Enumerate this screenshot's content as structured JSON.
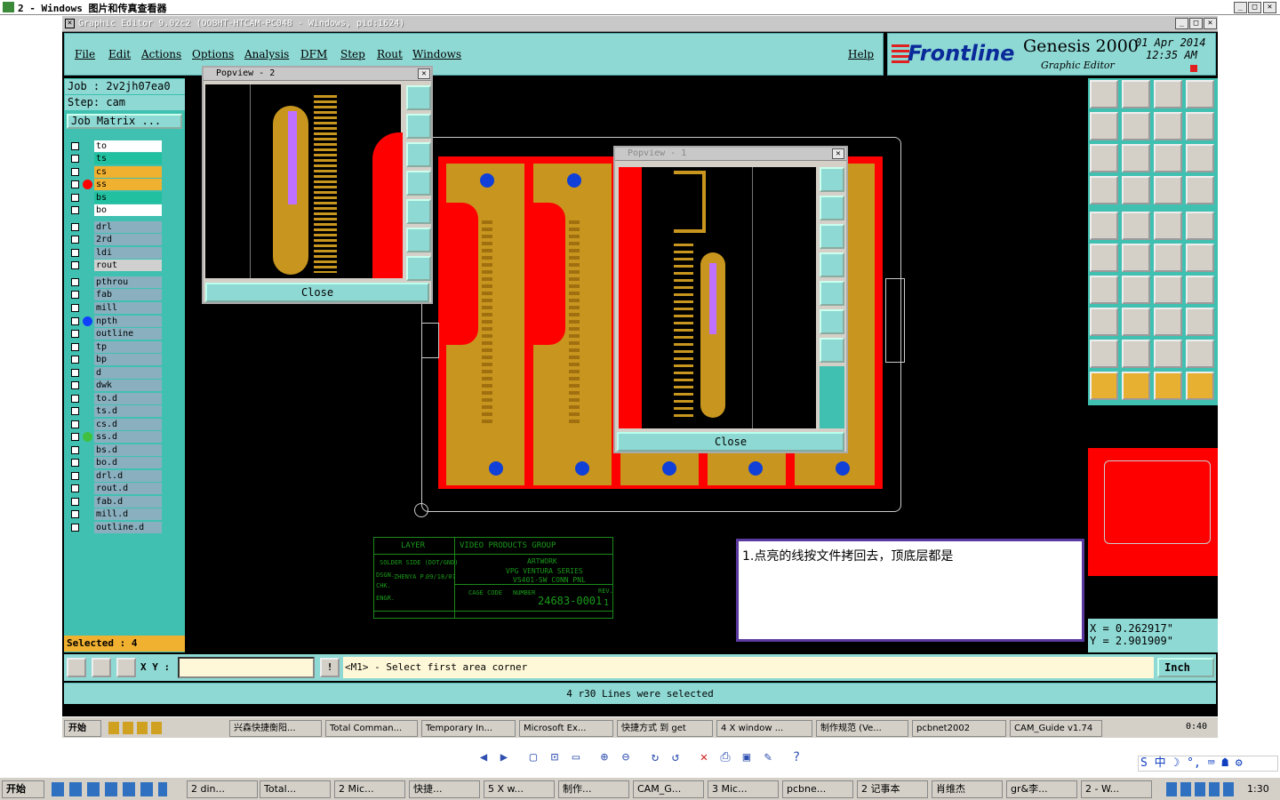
{
  "outer_window": {
    "title": "2 - Windows 图片和传真查看器"
  },
  "app_window": {
    "title": "Graphic Editor 9.02c2  (OOBHT-HTCAM-PC048 - Windows, pid:1624)"
  },
  "menu": {
    "items": [
      "File",
      "Edit",
      "Actions",
      "Options",
      "Analysis",
      "DFM",
      "Step",
      "Rout",
      "Windows"
    ],
    "help": "Help"
  },
  "brand": {
    "logo": "Frontline",
    "product": "Genesis 2000",
    "subtitle": "Graphic Editor",
    "date": "01 Apr 2014",
    "time": "12:35 AM"
  },
  "job": {
    "job_label": "Job : 2v2jh07ea0",
    "step_label": "Step: cam",
    "matrix_button": "Job Matrix ..."
  },
  "layers": [
    {
      "name": "to",
      "color": "#ffffff"
    },
    {
      "name": "ts",
      "color": "#20c0a0"
    },
    {
      "name": "cs",
      "color": "#f0b030"
    },
    {
      "name": "ss",
      "color": "#f0b030",
      "marker": "#ff0000"
    },
    {
      "name": "bs",
      "color": "#20c0a0"
    },
    {
      "name": "bo",
      "color": "#ffffff"
    },
    {
      "name": "drl",
      "color": "#8ab0c0"
    },
    {
      "name": "2rd",
      "color": "#8ab0c0"
    },
    {
      "name": "ldi",
      "color": "#8ab0c0"
    },
    {
      "name": "rout",
      "color": "#d0d0d0"
    },
    {
      "name": "pthrou",
      "color": "#8ab0c0"
    },
    {
      "name": "fab",
      "color": "#8ab0c0"
    },
    {
      "name": "mill",
      "color": "#8ab0c0"
    },
    {
      "name": "npth",
      "color": "#8ab0c0",
      "marker": "#1040ff"
    },
    {
      "name": "outline",
      "color": "#8ab0c0"
    },
    {
      "name": "tp",
      "color": "#8ab0c0"
    },
    {
      "name": "bp",
      "color": "#8ab0c0"
    },
    {
      "name": "d",
      "color": "#8ab0c0"
    },
    {
      "name": "dwk",
      "color": "#8ab0c0"
    },
    {
      "name": "to.d",
      "color": "#8ab0c0"
    },
    {
      "name": "ts.d",
      "color": "#8ab0c0"
    },
    {
      "name": "cs.d",
      "color": "#8ab0c0"
    },
    {
      "name": "ss.d",
      "color": "#8ab0c0",
      "marker": "#40c040"
    },
    {
      "name": "bs.d",
      "color": "#8ab0c0"
    },
    {
      "name": "bo.d",
      "color": "#8ab0c0"
    },
    {
      "name": "drl.d",
      "color": "#8ab0c0"
    },
    {
      "name": "rout.d",
      "color": "#8ab0c0"
    },
    {
      "name": "fab.d",
      "color": "#8ab0c0"
    },
    {
      "name": "mill.d",
      "color": "#8ab0c0"
    },
    {
      "name": "outline.d",
      "color": "#8ab0c0"
    }
  ],
  "selected": "Selected : 4",
  "popview2": {
    "title": "Popview - 2",
    "close": "Close"
  },
  "popview1": {
    "title": "Popview - 1",
    "close": "Close"
  },
  "titleblock": {
    "layer": "LAYER",
    "group": "VIDEO PRODUCTS GROUP",
    "solder_side": "SOLDER SIDE (DOT/GND)",
    "dsgn": "DSGN.",
    "dsgn_name": "ZHENYA P.",
    "dsgn_date": "09/18/07",
    "chk": "CHK.",
    "engr": "ENGR.",
    "artwork": "ARTWORK",
    "series": "VPG VENTURA SERIES",
    "part": "VS401-SW CONN PNL",
    "cage_code": "CAGE CODE",
    "number_label": "NUMBER",
    "number": "24683-0001",
    "rev_label": "REV.",
    "rev": "1"
  },
  "annotation": "1.点亮的线按文件拷回去，顶底层都是",
  "coords": {
    "x": "X = 0.262917\"",
    "y": "Y = 2.901909\""
  },
  "status": {
    "xy_label": "X Y :",
    "prompt": "<M1> - Select first area corner",
    "units": "Inch",
    "message": "4 r30 Lines were selected"
  },
  "inner_taskbar": {
    "start": "开始",
    "items": [
      "兴森快捷衡阳...",
      "Total Comman...",
      "Temporary In...",
      "Microsoft Ex...",
      "快捷方式 到 get",
      "4 X window ...",
      "制作规范 (Ve...",
      "pcbnet2002",
      "CAM_Guide v1.74"
    ],
    "clock": "0:40"
  },
  "taskbar": {
    "start": "开始",
    "items": [
      "2 din...",
      "Total...",
      "2 Mic...",
      "快捷...",
      "5 X w...",
      "制作...",
      "CAM_G...",
      "3 Mic...",
      "pcbne...",
      "2 记事本",
      "肖维杰",
      "gr&李...",
      "2 - W..."
    ],
    "clock": "1:30"
  },
  "colors": {
    "teal": "#8ed9d4",
    "copper": "#c8961e",
    "board_red": "#ff0000",
    "hole_blue": "#1040d8"
  }
}
